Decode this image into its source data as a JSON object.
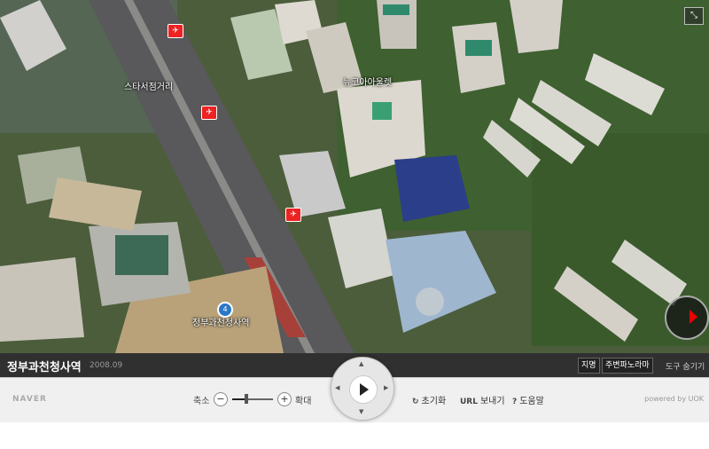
{
  "map": {
    "labels": [
      {
        "text": "스타서점거리"
      },
      {
        "text": "뉴코아아울렛"
      },
      {
        "text": "정부과천청사역"
      }
    ],
    "station_pin_glyph": "4"
  },
  "titlebar": {
    "place_name": "정부과천청사역",
    "date": "2008.09",
    "btn_map": "지명",
    "btn_panorama": "주변파노라마",
    "tools_toggle": "도구 숨기기"
  },
  "controls": {
    "brand": "NAVER",
    "zoom_out_label": "축소",
    "zoom_in_label": "확대",
    "zoom_level": 0.35,
    "reset_label": "초기화",
    "send_icon_text": "URL",
    "send_label": "보내기",
    "help_label": "도움말",
    "powered_by": "powered by UOK"
  },
  "colors": {
    "marker": "#e22222",
    "compass_needle": "#e00000",
    "station_pin": "#2a78c8"
  }
}
